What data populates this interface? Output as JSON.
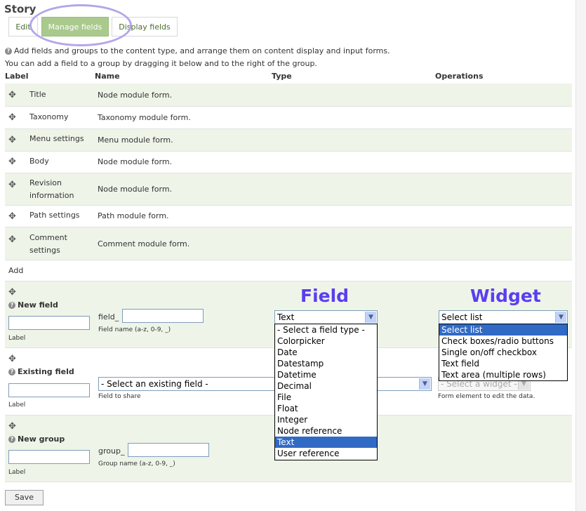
{
  "page": {
    "title": "Story"
  },
  "tabs": [
    {
      "label": "Edit"
    },
    {
      "label": "Manage fields"
    },
    {
      "label": "Display fields"
    }
  ],
  "help": {
    "line1": "Add fields and groups to the content type, and arrange them on content display and input forms.",
    "line2": "You can add a field to a group by dragging it below and to the right of the group."
  },
  "table": {
    "headers": [
      "Label",
      "Name",
      "Type",
      "Operations"
    ],
    "rows": [
      {
        "label": "Title",
        "name": "Node module form."
      },
      {
        "label": "Taxonomy",
        "name": "Taxonomy module form."
      },
      {
        "label": "Menu settings",
        "name": "Menu module form."
      },
      {
        "label": "Body",
        "name": "Node module form."
      },
      {
        "label_line1": "Revision",
        "label_line2": "information",
        "name": "Node module form."
      },
      {
        "label": "Path settings",
        "name": "Path module form."
      },
      {
        "label_line1": "Comment",
        "label_line2": "settings",
        "name": "Comment module form."
      }
    ],
    "add_label": "Add"
  },
  "new_field": {
    "title": "New field",
    "label_caption": "Label",
    "prefix": "field_",
    "name_caption": "Field name (a-z, 0-9, _)",
    "type_value": "Text",
    "widget_value": "Select list"
  },
  "existing_field": {
    "title": "Existing field",
    "label_caption": "Label",
    "select_value": "- Select an existing field -",
    "share_caption": "Field to share",
    "widget_placeholder": "- Select a widget -",
    "widget_caption": "Form element to edit the data."
  },
  "new_group": {
    "title": "New group",
    "label_caption": "Label",
    "prefix": "group_",
    "name_caption": "Group name (a-z, 0-9, _)"
  },
  "field_type_options": [
    "- Select a field type -",
    "Colorpicker",
    "Date",
    "Datestamp",
    "Datetime",
    "Decimal",
    "File",
    "Float",
    "Integer",
    "Node reference",
    "Text",
    "User reference"
  ],
  "field_type_selected": "Text",
  "widget_options": [
    "Select list",
    "Check boxes/radio buttons",
    "Single on/off checkbox",
    "Text field",
    "Text area (multiple rows)"
  ],
  "widget_selected": "Select list",
  "annotations": {
    "field": "Field",
    "widget": "Widget"
  },
  "save_label": "Save",
  "colors": {
    "accent": "#a9c98d",
    "annotation": "#5a3ef0",
    "dropdown_highlight": "#316ac5"
  }
}
